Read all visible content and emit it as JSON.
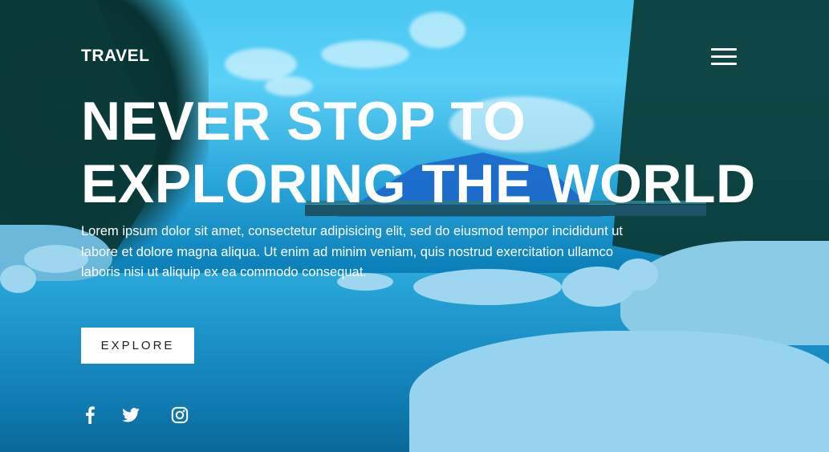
{
  "header": {
    "brand": "TRAVEL"
  },
  "hero": {
    "headline_line1": "NEVER STOP TO",
    "headline_line2": "EXPLORING THE WORLD",
    "description": "Lorem ipsum dolor sit amet, consectetur adipisicing elit, sed do eiusmod tempor incididunt ut labore et dolore magna aliqua. Ut enim ad minim veniam, quis nostrud exercitation ullamco laboris nisi ut aliquip ex ea commodo consequat.",
    "cta_label": "EXPLORE"
  },
  "social": {
    "icons": [
      "facebook-icon",
      "twitter-icon",
      "instagram-icon"
    ]
  },
  "colors": {
    "overlay_tint": "#2ab4ee",
    "text": "#ffffff",
    "button_bg": "#ffffff",
    "button_text": "#222222"
  }
}
